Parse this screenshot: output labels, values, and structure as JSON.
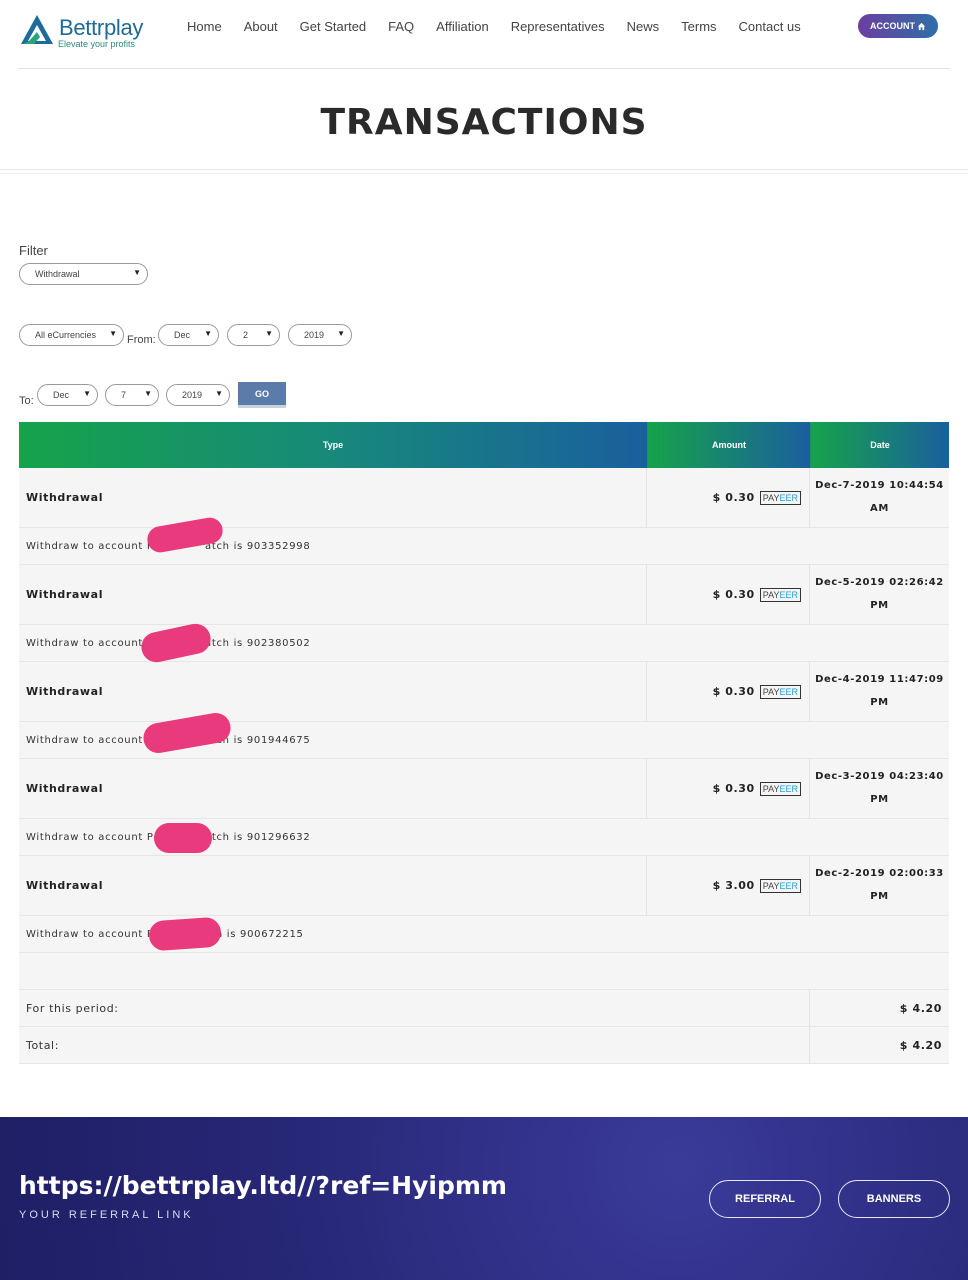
{
  "header": {
    "logo_name": "Bettrplay",
    "logo_tagline": "Elevate your profits",
    "nav": [
      "Home",
      "About",
      "Get Started",
      "FAQ",
      "Affiliation",
      "Representatives",
      "News",
      "Terms",
      "Contact us"
    ],
    "account_label": "ACCOUNT"
  },
  "page_title": "TRANSACTIONS",
  "filter": {
    "label": "Filter",
    "type_value": "Withdrawal",
    "currency_value": "All eCurrencies",
    "from_label": "From:",
    "from": {
      "month": "Dec",
      "day": "2",
      "year": "2019"
    },
    "to_label": "To:",
    "to": {
      "month": "Dec",
      "day": "7",
      "year": "2019"
    },
    "go_label": "GO"
  },
  "table": {
    "headers": {
      "type": "Type",
      "amount": "Amount",
      "date": "Date"
    },
    "rows": [
      {
        "type": "Withdrawal",
        "amount": "$ 0.30",
        "date_line1": "Dec-7-2019 10:44:54",
        "date_line2": "AM",
        "desc_prefix": "Withdraw to account P",
        "desc_suffix": "atch is 903352998"
      },
      {
        "type": "Withdrawal",
        "amount": "$ 0.30",
        "date_line1": "Dec-5-2019 02:26:42",
        "date_line2": "PM",
        "desc_prefix": "Withdraw to account P",
        "desc_suffix": "atch is 902380502"
      },
      {
        "type": "Withdrawal",
        "amount": "$ 0.30",
        "date_line1": "Dec-4-2019 11:47:09",
        "date_line2": "PM",
        "desc_prefix": "Withdraw to account P",
        "desc_suffix": "atch is 901944675"
      },
      {
        "type": "Withdrawal",
        "amount": "$ 0.30",
        "date_line1": "Dec-3-2019 04:23:40",
        "date_line2": "PM",
        "desc_prefix": "Withdraw to account P6",
        "desc_suffix": "atch is 901296632"
      },
      {
        "type": "Withdrawal",
        "amount": "$ 3.00",
        "date_line1": "Dec-2-2019 02:00:33",
        "date_line2": "PM",
        "desc_prefix": "Withdraw to account P6",
        "desc_suffix": "tch is 900672215"
      }
    ],
    "payment_badge": {
      "part1": "PAY",
      "part2": "EER"
    },
    "period_label": "For this period:",
    "period_value": "$ 4.20",
    "total_label": "Total:",
    "total_value": "$ 4.20"
  },
  "footer": {
    "referral_url": "https://bettrplay.ltd//?ref=Hyipmm",
    "referral_label": "YOUR REFERRAL LINK",
    "referral_button": "REFERRAL",
    "banners_button": "BANNERS"
  },
  "colors": {
    "header_gradient_start": "#16a34a",
    "header_gradient_end": "#1a5f9e",
    "redaction": "#e83a7c",
    "footer_bg": "#262675",
    "go_button": "#5b7cab"
  }
}
